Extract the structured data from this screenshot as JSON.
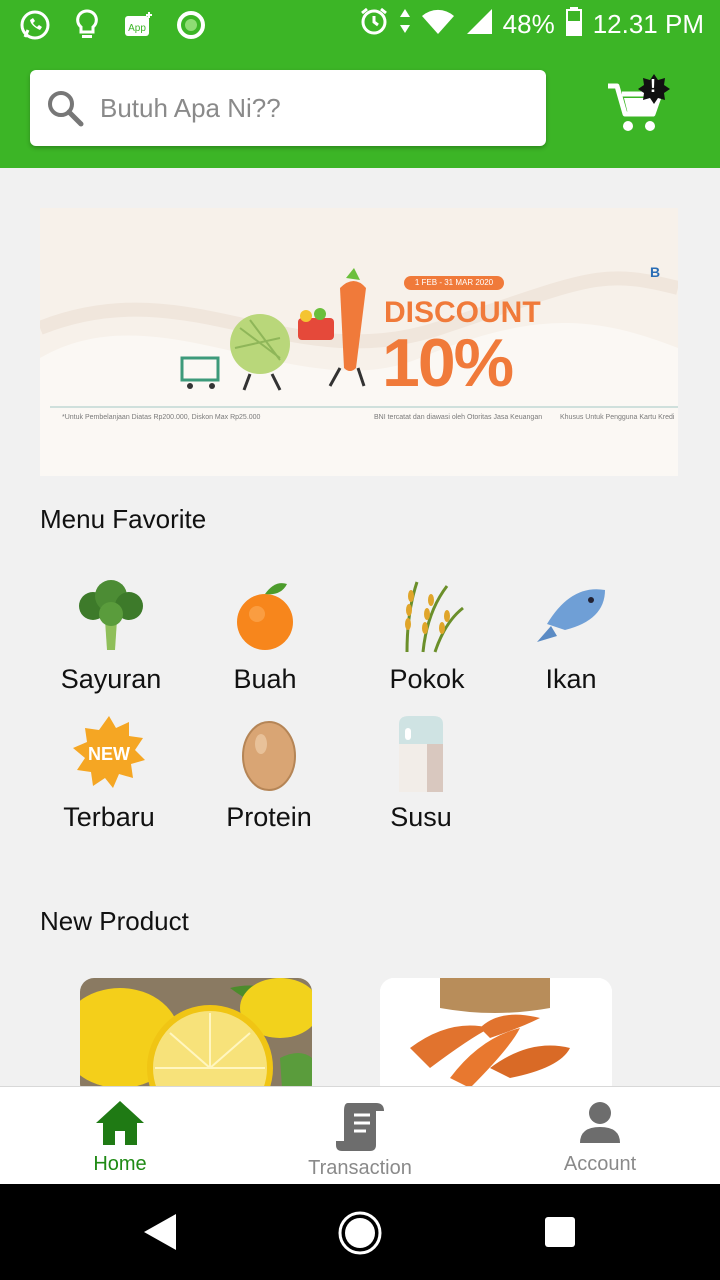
{
  "status_bar": {
    "time": "12.31 PM",
    "battery": "48%",
    "notification_icons": [
      "whatsapp-icon",
      "lightbulb-icon",
      "app-icon",
      "circle-notification-icon"
    ],
    "system_icons": [
      "alarm-icon",
      "data-arrows-icon",
      "wifi-icon",
      "signal-icon",
      "battery-icon"
    ]
  },
  "header": {
    "search_placeholder": "Butuh Apa Ni??",
    "cart_badge": "!"
  },
  "banner": {
    "date_range": "1 FEB - 31 MAR 2020",
    "discount_word": "DISCOUNT",
    "discount_value": "10%",
    "brand_text": "B",
    "fine_print_left": "*Untuk Pembelanjaan Diatas Rp200.000, Diskon Max Rp25.000",
    "fine_print_mid": "BNI tercatat dan diawasi oleh Otoritas Jasa Keuangan",
    "fine_print_right": "Khusus Untuk Pengguna Kartu Kredi"
  },
  "menu_favorite": {
    "title": "Menu Favorite",
    "items": [
      {
        "label": "Sayuran",
        "icon": "broccoli-icon"
      },
      {
        "label": "Buah",
        "icon": "orange-icon"
      },
      {
        "label": "Pokok",
        "icon": "rice-icon"
      },
      {
        "label": "Ikan",
        "icon": "fish-icon"
      },
      {
        "label": "Terbaru",
        "icon": "new-badge-icon",
        "badge_text": "NEW"
      },
      {
        "label": "Protein",
        "icon": "egg-icon"
      },
      {
        "label": "Susu",
        "icon": "milk-icon"
      }
    ]
  },
  "new_product": {
    "title": "New Product",
    "items": [
      {
        "image": "lemon-image"
      },
      {
        "image": "turmeric-image"
      }
    ]
  },
  "bottom_nav": {
    "items": [
      {
        "label": "Home",
        "icon": "home-icon",
        "active": true
      },
      {
        "label": "Transaction",
        "icon": "receipt-icon",
        "active": false
      },
      {
        "label": "Account",
        "icon": "person-icon",
        "active": false
      }
    ]
  },
  "colors": {
    "brand_green": "#3cb526",
    "active_nav": "#1f8a14",
    "discount_orange": "#f07a3a"
  }
}
